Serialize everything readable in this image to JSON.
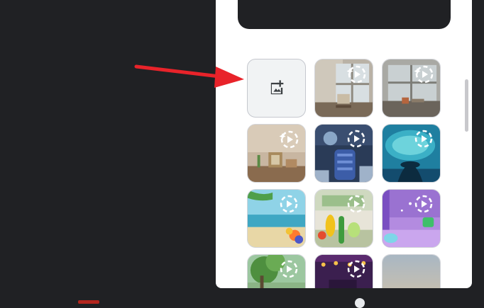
{
  "panel": {
    "tiles": [
      {
        "name": "add-background-tile",
        "kind": "add",
        "icon": "add-image-icon"
      },
      {
        "name": "background-tile-window-books",
        "kind": "photo",
        "badge": "animated-sparkle-play-icon"
      },
      {
        "name": "background-tile-window-mug",
        "kind": "photo",
        "badge": "animated-sparkle-play-icon"
      },
      {
        "name": "background-tile-shelf-frame",
        "kind": "photo",
        "badge": "animated-sparkle-play-icon"
      },
      {
        "name": "background-tile-spaceship-seat",
        "kind": "animated",
        "badge": "animated-play-icon"
      },
      {
        "name": "background-tile-underwater",
        "kind": "animated",
        "badge": "animated-play-icon"
      },
      {
        "name": "background-tile-beach",
        "kind": "animated",
        "badge": "animated-play-icon"
      },
      {
        "name": "background-tile-fruit-characters",
        "kind": "animated",
        "badge": "animated-play-icon"
      },
      {
        "name": "background-tile-purple-room",
        "kind": "animated",
        "badge": "animated-play-icon"
      },
      {
        "name": "background-tile-forest",
        "kind": "animated",
        "badge": "animated-play-icon"
      },
      {
        "name": "background-tile-night-lights",
        "kind": "animated",
        "badge": "animated-play-icon"
      },
      {
        "name": "background-tile-sky-gradient",
        "kind": "photo",
        "badge": ""
      }
    ]
  },
  "annotation": {
    "icon": "red-arrow-icon",
    "color": "#e8232a"
  }
}
